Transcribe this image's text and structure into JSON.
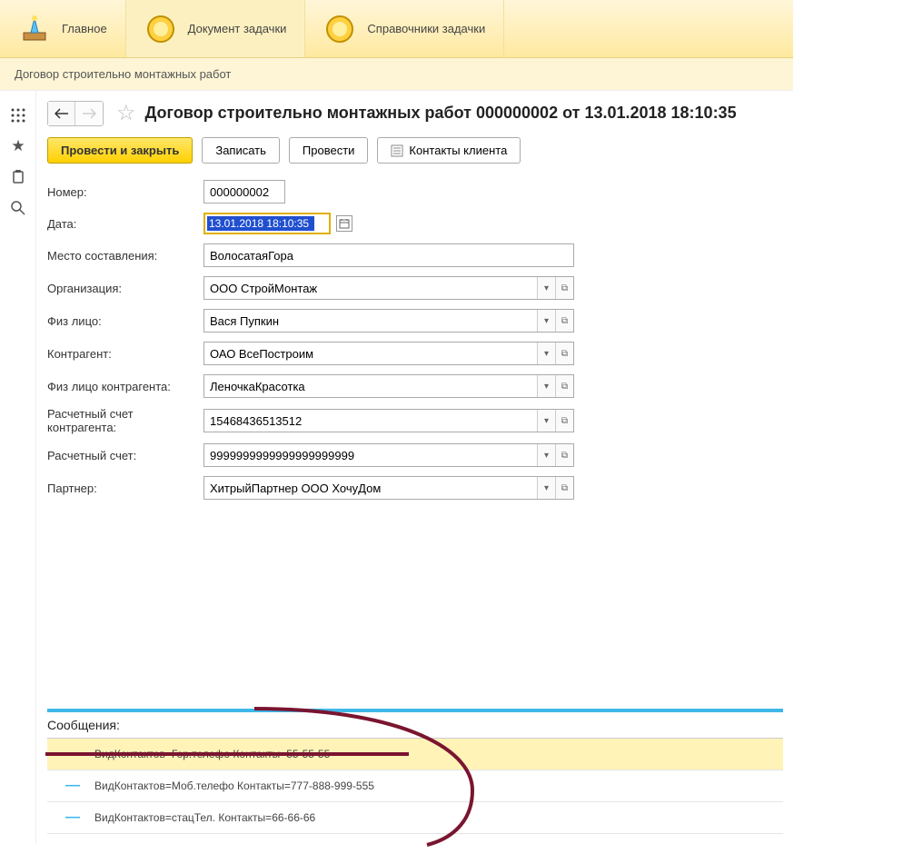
{
  "nav": {
    "tabs": [
      {
        "label": "Главное",
        "icon": "desk"
      },
      {
        "label": "Документ задачки",
        "icon": "coin"
      },
      {
        "label": "Справочники задачки",
        "icon": "coin"
      }
    ]
  },
  "breadcrumb": "Договор строительно монтажных работ",
  "page_title": "Договор строительно монтажных работ 000000002 от 13.01.2018 18:10:35",
  "toolbar": {
    "save_close": "Провести и закрыть",
    "write": "Записать",
    "post": "Провести",
    "contacts": "Контакты клиента"
  },
  "form": {
    "number_label": "Номер:",
    "number_value": "000000002",
    "date_label": "Дата:",
    "date_value": "13.01.2018 18:10:35",
    "place_label": "Место составления:",
    "place_value": "ВолосатаяГора",
    "org_label": "Организация:",
    "org_value": "ООО СтройМонтаж",
    "person_label": "Физ лицо:",
    "person_value": "Вася Пупкин",
    "counterparty_label": "Контрагент:",
    "counterparty_value": "ОАО ВсеПостроим",
    "cp_person_label": "Физ лицо контрагента:",
    "cp_person_value": "ЛеночкаКрасотка",
    "cp_account_label": "Расчетный счет контрагента:",
    "cp_account_value": "15468436513512",
    "account_label": "Расчетный счет:",
    "account_value": "9999999999999999999999",
    "partner_label": "Партнер:",
    "partner_value": "ХитрыйПартнер ООО ХочуДом"
  },
  "messages": {
    "header": "Сообщения:",
    "items": [
      "ВидКонтактов=Гор.телефо Контакты=55-55-55",
      "ВидКонтактов=Моб.телефо Контакты=777-888-999-555",
      "ВидКонтактов=стацТел. Контакты=66-66-66"
    ]
  }
}
